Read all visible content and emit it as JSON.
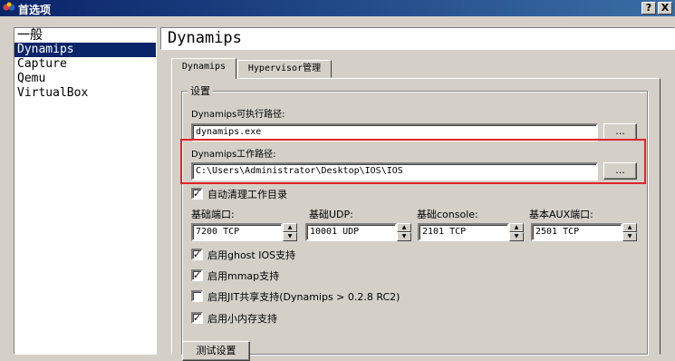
{
  "window": {
    "title": "首选项",
    "help_button": "?",
    "close_button": "X"
  },
  "nav": {
    "items": [
      "一般",
      "Dynamips",
      "Capture",
      "Qemu",
      "VirtualBox"
    ],
    "selected": "Dynamips"
  },
  "page_title": "Dynamips",
  "tabs": [
    "Dynamips",
    "Hypervisor管理"
  ],
  "settings": {
    "group_label": "设置",
    "exec_path_label": "Dynamips可执行路径:",
    "exec_path_value": "dynamips.exe",
    "browse_label": "...",
    "work_dir_label": "Dynamips工作路径:",
    "work_dir_value": "C:\\Users\\Administrator\\Desktop\\IOS\\IOS",
    "clean_workdir": {
      "label": "自动清理工作目录",
      "checked": true
    },
    "base_port": {
      "label": "基础端口:",
      "value": "7200 TCP"
    },
    "base_udp": {
      "label": "基础UDP:",
      "value": "10001 UDP"
    },
    "base_console": {
      "label": "基础console:",
      "value": "2101 TCP"
    },
    "base_aux": {
      "label": "基本AUX端口:",
      "value": "2501 TCP"
    },
    "ghost_ios": {
      "label": "启用ghost IOS支持",
      "checked": true
    },
    "mmap": {
      "label": "启用mmap支持",
      "checked": true
    },
    "jit": {
      "label": "启用JIT共享支持(Dynamips > 0.2.8 RC2)",
      "checked": false
    },
    "sparse_mem": {
      "label": "启用小内存支持",
      "checked": true
    },
    "test_button": "测试设置"
  },
  "colors": {
    "titlebar": "#0a246a",
    "selection": "#0a246a",
    "highlight_box": "#e0242a",
    "face": "#d4d0c8"
  }
}
